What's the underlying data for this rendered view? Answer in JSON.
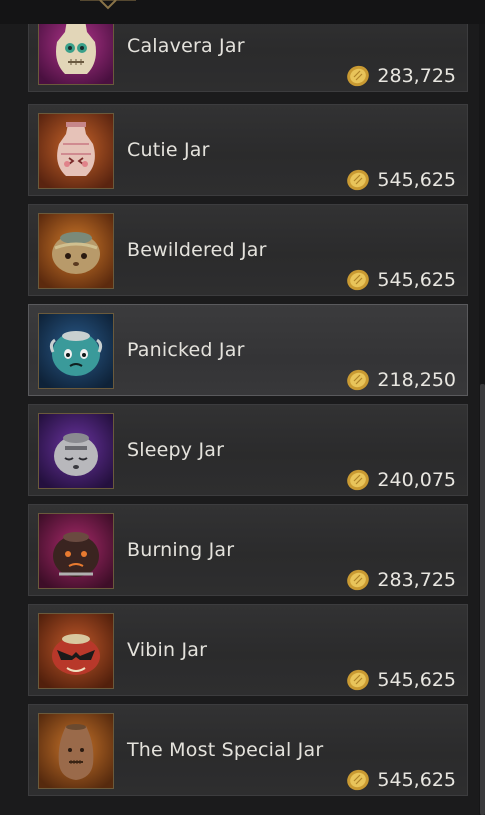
{
  "items": [
    {
      "name": "Calavera Jar",
      "price": "283,725",
      "rarity_color": "#9a2a7a",
      "icon": "calavera-jar-icon"
    },
    {
      "name": "Cutie Jar",
      "price": "545,625",
      "rarity_color": "#a8521e",
      "icon": "cutie-jar-icon"
    },
    {
      "name": "Bewildered Jar",
      "price": "545,625",
      "rarity_color": "#a8521e",
      "icon": "bewildered-jar-icon"
    },
    {
      "name": "Panicked Jar",
      "price": "218,250",
      "rarity_color": "#2a4f7a",
      "icon": "panicked-jar-icon"
    },
    {
      "name": "Sleepy Jar",
      "price": "240,075",
      "rarity_color": "#5a2a8a",
      "icon": "sleepy-jar-icon"
    },
    {
      "name": "Burning Jar",
      "price": "283,725",
      "rarity_color": "#9a2a6a",
      "icon": "burning-jar-icon"
    },
    {
      "name": "Vibin Jar",
      "price": "545,625",
      "rarity_color": "#a8521e",
      "icon": "vibin-jar-icon"
    },
    {
      "name": "The Most Special Jar",
      "price": "545,625",
      "rarity_color": "#a8521e",
      "icon": "most-special-jar-icon"
    }
  ],
  "currency_icon": "gold-coin-icon",
  "currency_color": "#d9b24a"
}
